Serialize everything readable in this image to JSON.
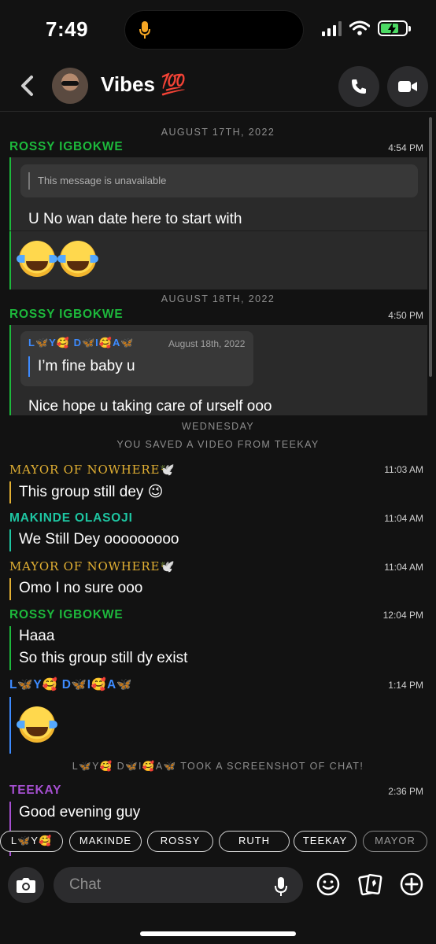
{
  "status_bar": {
    "time": "7:49"
  },
  "header": {
    "title": "Vibes 💯"
  },
  "chat": {
    "dates": [
      "AUGUST 17TH, 2022",
      "AUGUST 18TH, 2022",
      "WEDNESDAY"
    ],
    "system_notices": [
      "YOU SAVED A VIDEO FROM TEEKAY",
      "L🦋Y🥰 D🦋I🥰A🦋 TOOK A SCREENSHOT OF CHAT!"
    ],
    "messages": [
      {
        "sender": "ROSSY IGBOKWE",
        "time": "4:54 PM",
        "quote": "This message is unavailable",
        "text": "U No wan date here to start with",
        "emoji": "😂😂"
      },
      {
        "sender": "ROSSY IGBOKWE",
        "time": "4:50 PM",
        "quote_sender": "L🦋Y🥰 D🦋I🥰A🦋",
        "quote_date": "August 18th, 2022",
        "quote_text": "I’m fine baby u",
        "text": "Nice hope u taking care of urself ooo"
      },
      {
        "sender": "MAYOR OF NOWHERE🕊️",
        "time": "11:03 AM",
        "text": "This group still dey 😉"
      },
      {
        "sender": "MAKINDE OLASOJI",
        "time": "11:04 AM",
        "text": "We Still Dey ooooooooo"
      },
      {
        "sender": "MAYOR OF NOWHERE🕊️",
        "time": "11:04 AM",
        "text": "Omo I no sure ooo"
      },
      {
        "sender": "ROSSY IGBOKWE",
        "time": "12:04 PM",
        "lines": [
          "Haaa",
          "So this group still dy exist"
        ]
      },
      {
        "sender": "L🦋Y🥰 D🦋I🥰A🦋",
        "time": "1:14 PM",
        "emoji": "😂"
      },
      {
        "sender": "TEEKAY",
        "time": "2:36 PM",
        "text": "Good evening guy"
      }
    ]
  },
  "mention_chips": [
    "L🦋Y🥰",
    "MAKINDE",
    "ROSSY",
    "RUTH",
    "TEEKAY",
    "MAYOR"
  ],
  "composer": {
    "placeholder": "Chat"
  },
  "colors": {
    "rossy": "#1db93c",
    "mayor": "#e2b033",
    "makinde": "#1ec6a2",
    "lydia": "#3d8bff",
    "teekay": "#a64fd1"
  }
}
